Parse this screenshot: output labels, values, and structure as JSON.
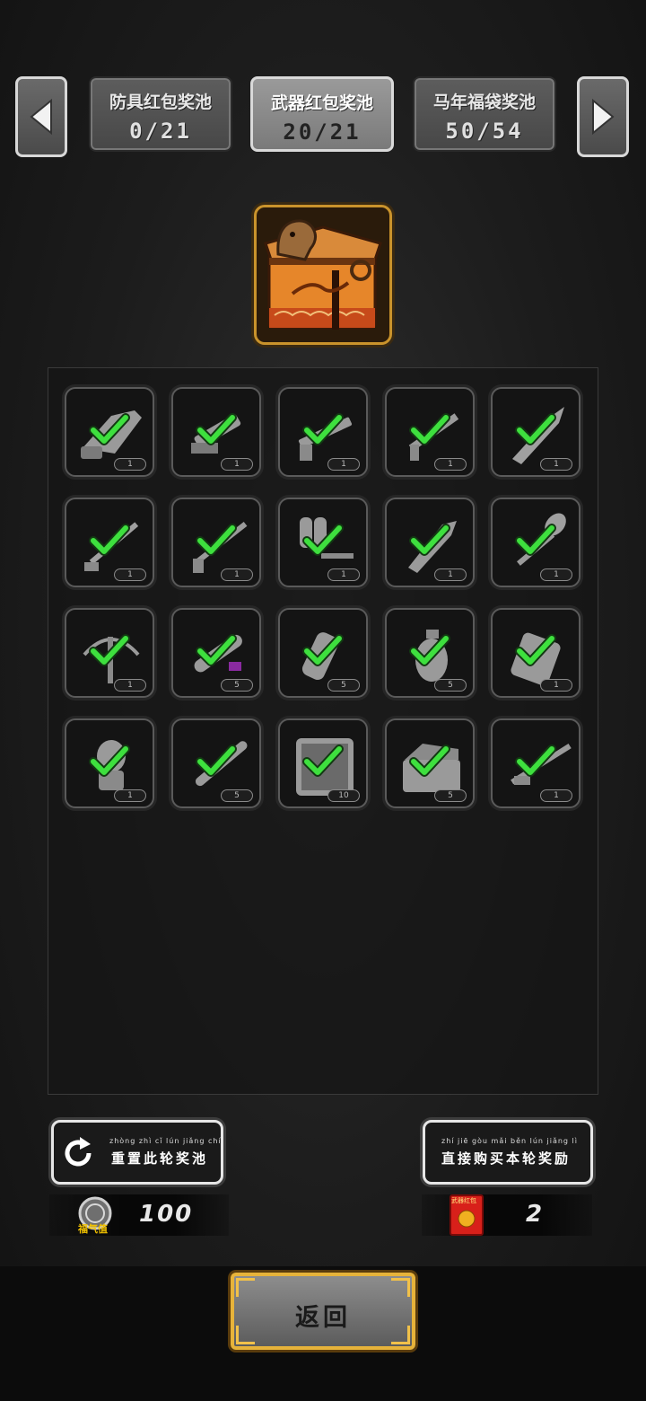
{
  "tabs": [
    {
      "name": "防具红包奖池",
      "count": "0/21",
      "active": false
    },
    {
      "name": "武器红包奖池",
      "count": "20/21",
      "active": true
    },
    {
      "name": "马年福袋奖池",
      "count": "50/54",
      "active": false
    }
  ],
  "grid": {
    "items": [
      {
        "icon": "chainsaw-icon",
        "qty": "1",
        "obtained": true
      },
      {
        "icon": "minigun-icon",
        "qty": "1",
        "obtained": true
      },
      {
        "icon": "shotgun-icon",
        "qty": "1",
        "obtained": true
      },
      {
        "icon": "assault-rifle-icon",
        "qty": "1",
        "obtained": true
      },
      {
        "icon": "combat-knife-icon",
        "qty": "1",
        "obtained": true
      },
      {
        "icon": "sword-icon",
        "qty": "1",
        "obtained": true
      },
      {
        "icon": "rifle-icon",
        "qty": "1",
        "obtained": true
      },
      {
        "icon": "flamethrower-icon",
        "qty": "1",
        "obtained": true
      },
      {
        "icon": "machete-icon",
        "qty": "1",
        "obtained": true
      },
      {
        "icon": "shovel-icon",
        "qty": "1",
        "obtained": true
      },
      {
        "icon": "crossbow-icon",
        "qty": "1",
        "obtained": true
      },
      {
        "icon": "rocket-ammo-icon",
        "qty": "5",
        "obtained": true
      },
      {
        "icon": "flashbang-icon",
        "qty": "5",
        "obtained": true
      },
      {
        "icon": "frag-grenade-icon",
        "qty": "5",
        "obtained": true
      },
      {
        "icon": "c4-explosive-icon",
        "qty": "1",
        "obtained": true
      },
      {
        "icon": "stick-grenade-icon",
        "qty": "1",
        "obtained": true
      },
      {
        "icon": "rpg-round-icon",
        "qty": "5",
        "obtained": true
      },
      {
        "icon": "tool-case-icon",
        "qty": "10",
        "obtained": true
      },
      {
        "icon": "toolbox-icon",
        "qty": "5",
        "obtained": true
      },
      {
        "icon": "sniper-rifle-icon",
        "qty": "1",
        "obtained": true
      }
    ]
  },
  "reset_button": {
    "pinyin": "zhòng zhì  cǐ  lún jiǎng chí",
    "label": "重置此轮奖池"
  },
  "buy_button": {
    "pinyin": "zhí  jiē gòu mǎi běn lún jiǎng lì",
    "label": "直接购买本轮奖励"
  },
  "currency": {
    "luck_label": "福气值",
    "luck_value": "100",
    "envelope_label": "武器红包",
    "envelope_value": "2"
  },
  "back_button": {
    "label": "返回"
  },
  "colors": {
    "check": "#3ee03e",
    "frame_gold": "#e7b33a",
    "chest_orange": "#e6862a"
  }
}
